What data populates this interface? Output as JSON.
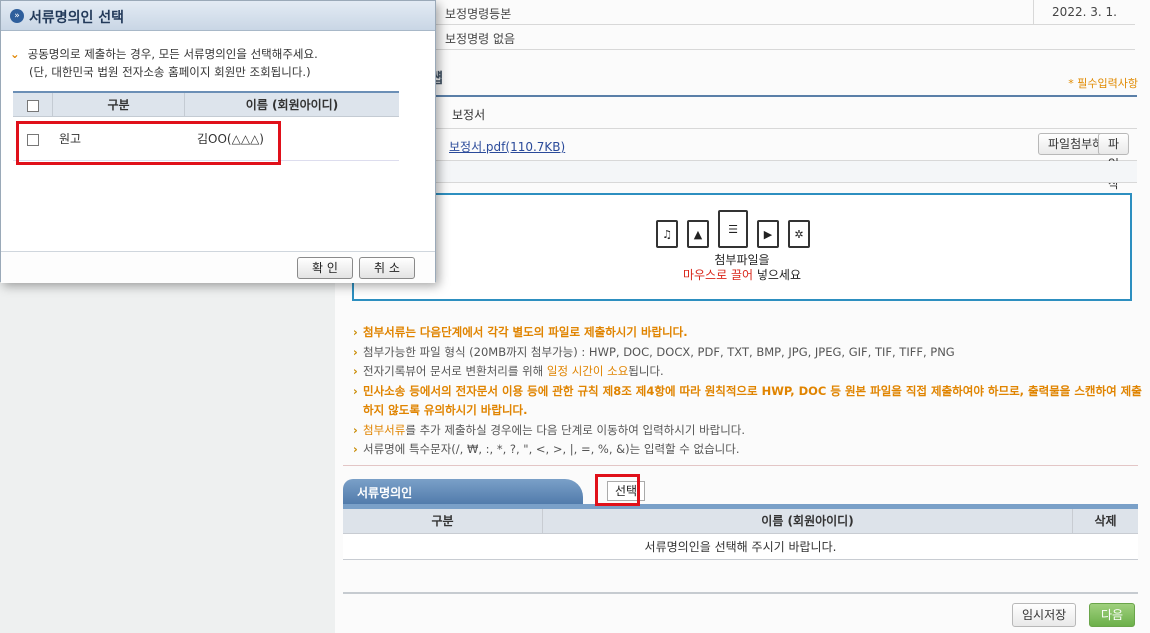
{
  "info": {
    "row1": "보정명령등본",
    "row1_date": "2022. 3. 1.",
    "row2": "보정명령 없음",
    "heading_fragment": "썝",
    "required_note": "* 필수입력사항"
  },
  "attachment": {
    "doc_name": "보정서",
    "file_link": "보정서.pdf(110.7KB)",
    "attach_button": "파일첨부하기",
    "delete_button": "파일삭제하기"
  },
  "dropzone": {
    "line1": "첨부파일을",
    "line2_red": "마우스로 끌어",
    "line2_rest": " 넣으세요",
    "icons": [
      "music-file-icon",
      "image-file-icon",
      "document-file-icon",
      "video-file-icon",
      "settings-file-icon"
    ]
  },
  "notes": [
    "첨부서류는 다음단계에서 각각 별도의 파일로 제출하시기 바랍니다.",
    "첨부가능한 파일 형식 (20MB까지 첨부가능) : HWP, DOC, DOCX, PDF, TXT, BMP, JPG, JPEG, GIF, TIF, TIFF, PNG",
    "민사소송 등에서의 전자문서 이용 등에 관한 규칙 제8조 제4항에 따라 원칙적으로 HWP, DOC 등 원본 파일을 직접 제출하여야 하므로, 출력물을 스캔하여 제출하지 않도록 유의하시기 바랍니다.",
    "서류명에 특수문자(/, ₩, :, *, ?, \", <, >, |, =, %, &)는 입력할 수 없습니다."
  ],
  "note_mixed": {
    "n2_prefix": "전자기록뷰어 문서로 변환처리를 위해 ",
    "n2_highlight": "일정 시간이 소요",
    "n2_suffix": "됩니다.",
    "n4_highlight": "첨부서류",
    "n4_suffix": "를 추가 제출하실 경우에는 다음 단계로 이동하여 입력하시기 바랍니다."
  },
  "signer_section": {
    "tab_label": "서류명의인",
    "select_button": "선택",
    "columns": [
      "구분",
      "이름 (회원아이디)",
      "삭제"
    ],
    "empty_message": "서류명의인을 선택해 주시기 바랍니다."
  },
  "footer": {
    "temp_save": "임시저장",
    "next": "다음"
  },
  "dialog": {
    "title": "서류명의인 선택",
    "message_line1": "공동명의로 제출하는 경우, 모든 서류명의인을 선택해주세요.",
    "message_line2": "(단, 대한민국 법원 전자소송 홈페이지 회원만 조회됩니다.)",
    "columns": [
      "구분",
      "이름 (회원아이디)"
    ],
    "rows": [
      {
        "type": "원고",
        "name": "김OO(△△△)"
      }
    ],
    "confirm": "확 인",
    "cancel": "취 소"
  },
  "colors": {
    "highlight_box": "#e0101a",
    "accent_orange": "#e08400",
    "tab_blue": "#4d77a8"
  }
}
